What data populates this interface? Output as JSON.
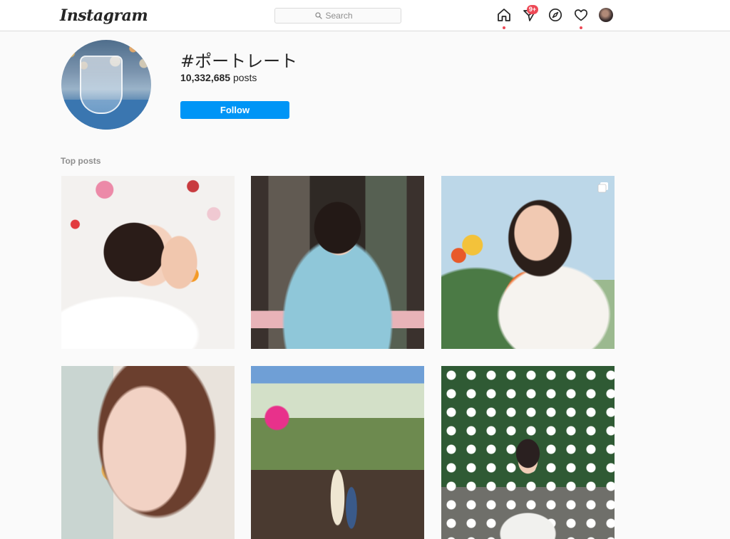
{
  "header": {
    "logo": "Instagram",
    "search_placeholder": "Search",
    "notifications_badge": "9+"
  },
  "icons": {
    "home": "home-icon",
    "direct": "paper-plane-icon",
    "explore": "compass-icon",
    "activity": "heart-icon",
    "profile": "avatar"
  },
  "hashtag": {
    "title": "#ポートレート",
    "post_count": "10,332,685",
    "post_count_suffix": "posts",
    "follow_label": "Follow"
  },
  "top_posts": {
    "label": "Top posts",
    "items": [
      {
        "id": 1,
        "multi": false
      },
      {
        "id": 2,
        "multi": false
      },
      {
        "id": 3,
        "multi": true
      },
      {
        "id": 4,
        "multi": false
      },
      {
        "id": 5,
        "multi": false
      },
      {
        "id": 6,
        "multi": false
      }
    ]
  },
  "colors": {
    "accent": "#0095f6",
    "notification": "#ed4956",
    "border": "#dbdbdb",
    "muted_text": "#8e8e8e",
    "background": "#fafafa"
  }
}
